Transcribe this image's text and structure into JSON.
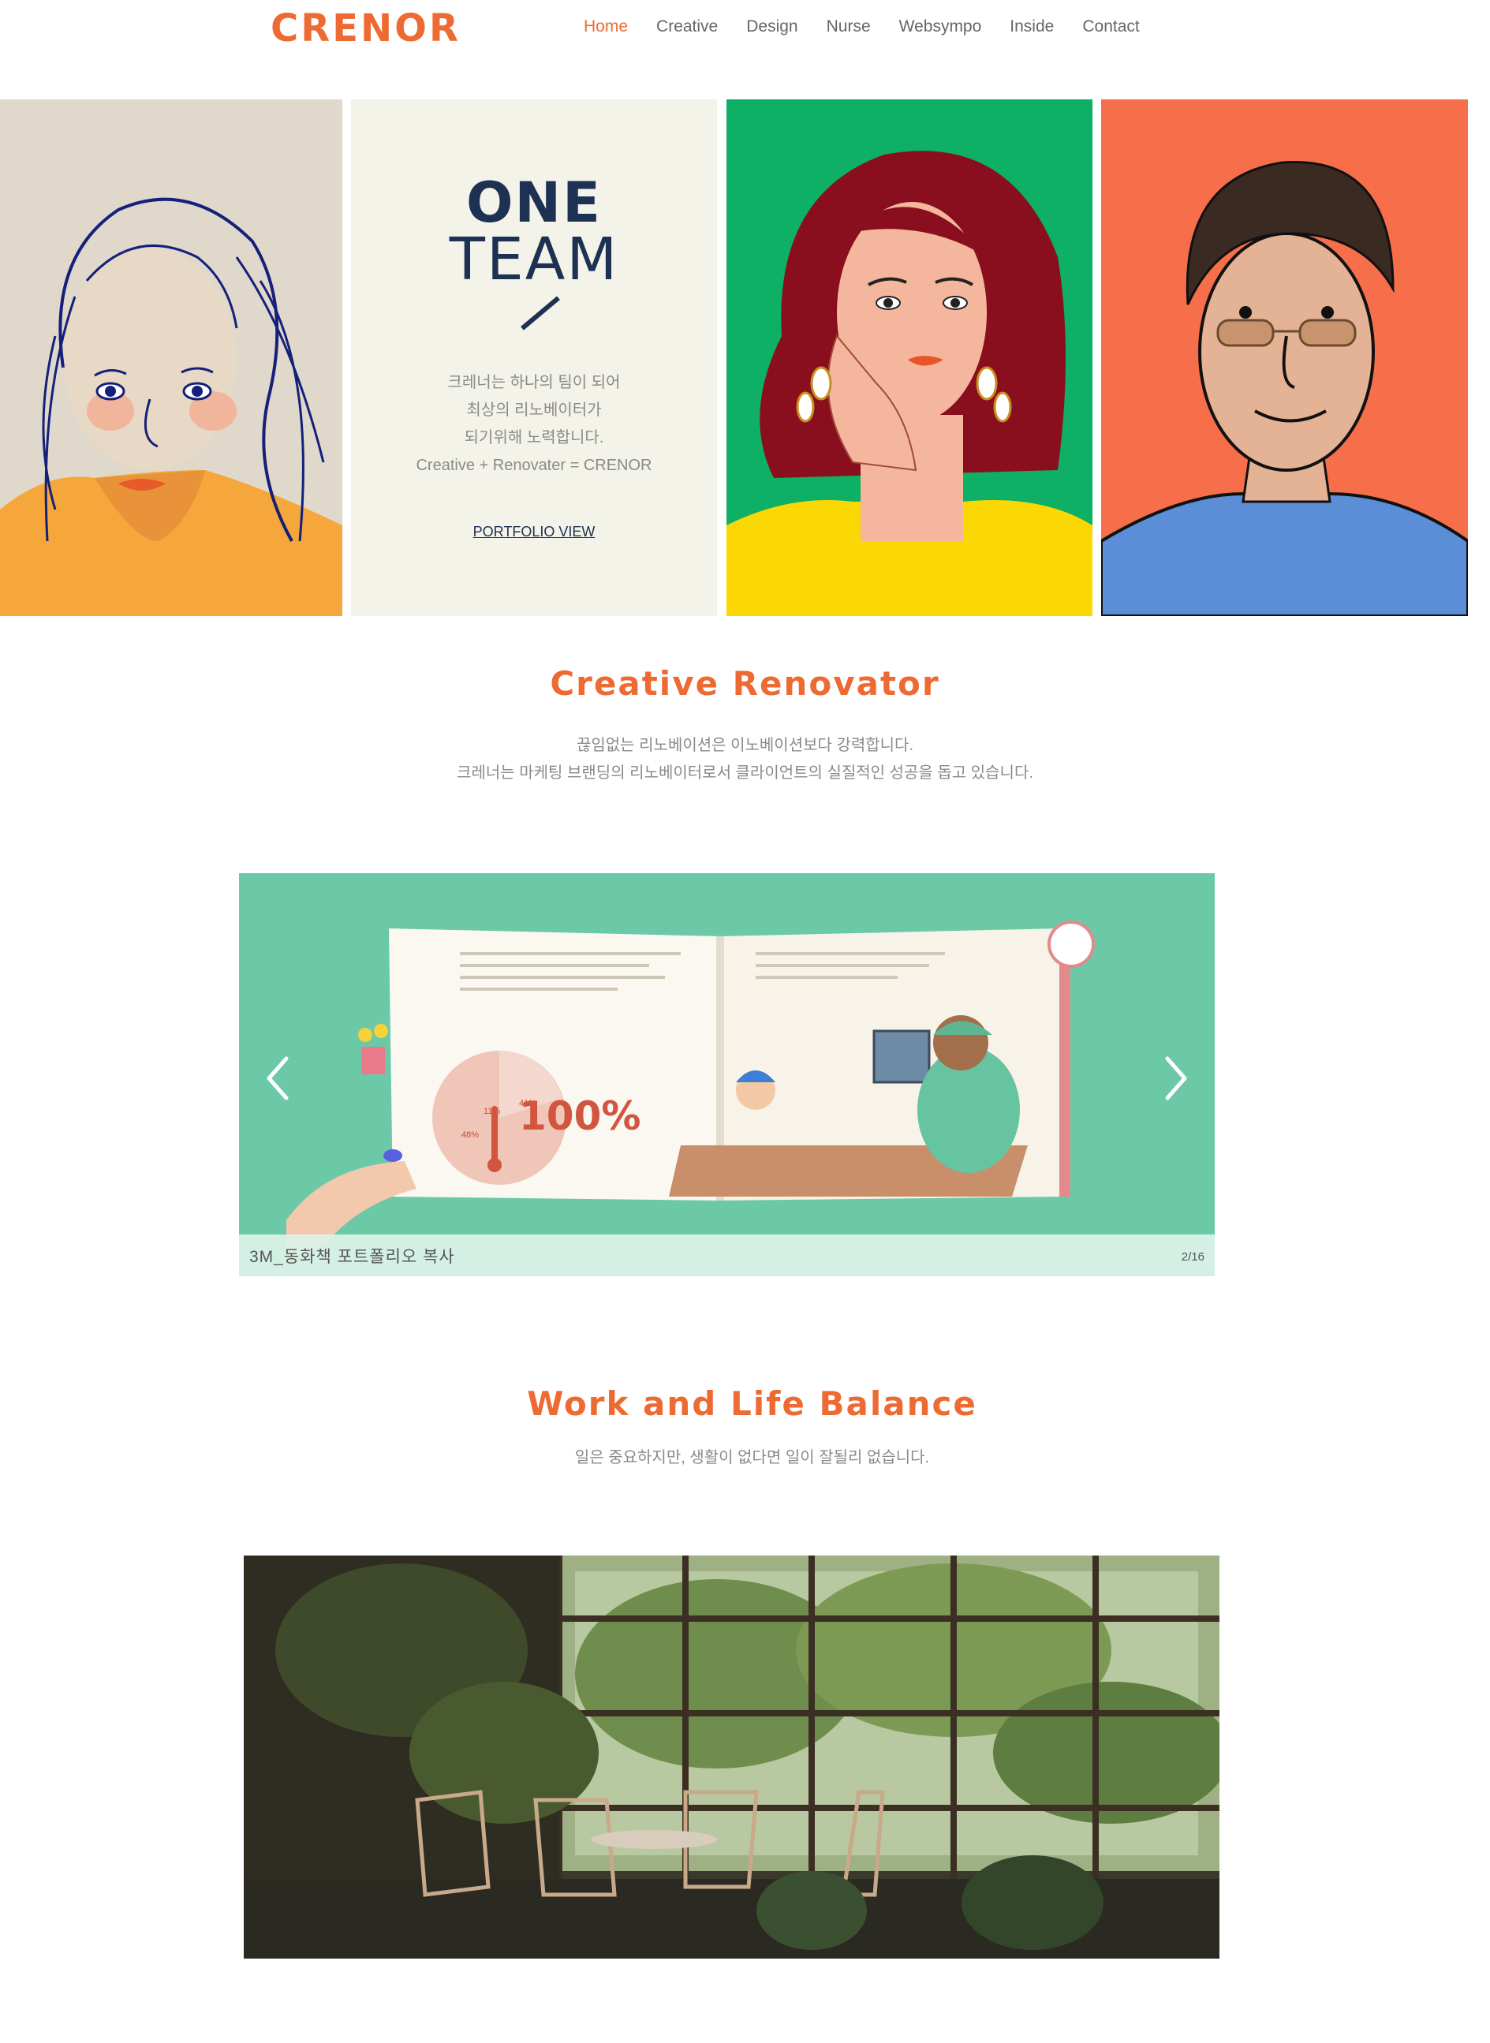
{
  "header": {
    "logo": "CRENOR",
    "nav": [
      {
        "label": "Home",
        "active": true
      },
      {
        "label": "Creative",
        "active": false
      },
      {
        "label": "Design",
        "active": false
      },
      {
        "label": "Nurse",
        "active": false
      },
      {
        "label": "Websympo",
        "active": false
      },
      {
        "label": "Inside",
        "active": false
      },
      {
        "label": "Contact",
        "active": false
      }
    ]
  },
  "hero": {
    "heading_line1": "ONE",
    "heading_line2": "TEAM",
    "intro_lines": [
      "크레너는 하나의 팀이 되어",
      "최상의 리노베이터가",
      "되기위해 노력합니다.",
      "Creative + Renovater = CRENOR"
    ],
    "link": "PORTFOLIO VIEW"
  },
  "section1": {
    "title": "Creative Renovator",
    "line1": "끊임없는 리노베이션은 이노베이션보다 강력합니다.",
    "line2": "크레너는 마케팅 브랜딩의 리노베이터로서 클라이언트의 실질적인 성공을 돕고 있습니다."
  },
  "slideshow": {
    "caption": "3M_동화책 포트폴리오 복사",
    "counter": "2/16",
    "book_text": {
      "big_number": "100%",
      "pie_labels": [
        "11%",
        "41%",
        "48%"
      ]
    }
  },
  "section2": {
    "title": "Work and Life Balance",
    "line1": "일은 중요하지만, 생활이 없다면 일이 잘될리 없습니다."
  },
  "colors": {
    "accent": "#ee6a33",
    "navy": "#1d3152",
    "mint": "#6cc9a7"
  }
}
